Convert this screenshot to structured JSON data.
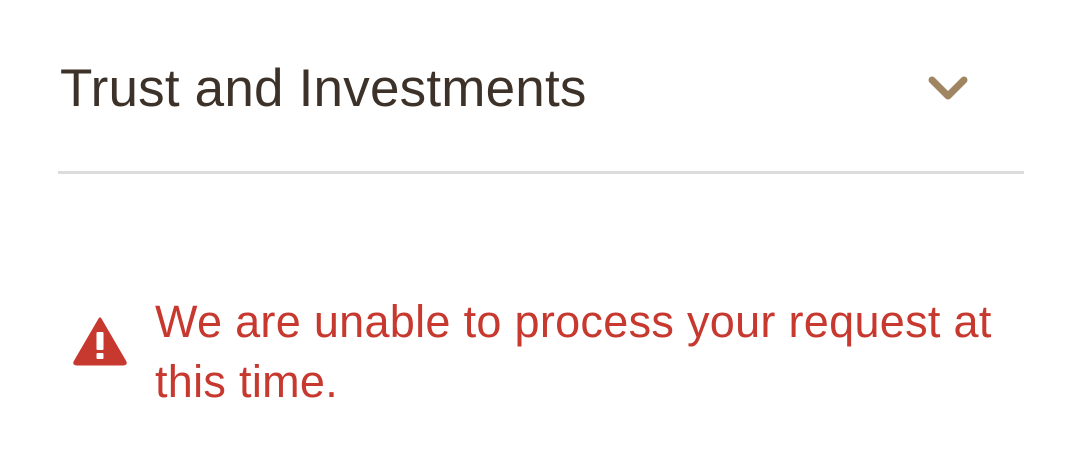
{
  "accordion": {
    "title": "Trust and Investments",
    "expand_icon": "chevron-down-icon",
    "accent_color": "#a08562"
  },
  "error": {
    "icon": "warning-icon",
    "message": "We are unable to process your request at this time.",
    "color": "#c7382f"
  }
}
